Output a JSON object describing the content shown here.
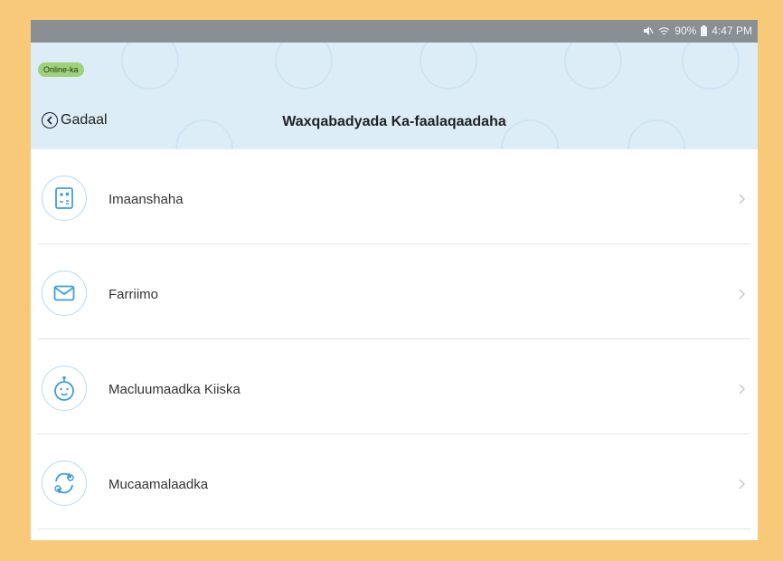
{
  "status_bar": {
    "battery": "90%",
    "time": "4:47 PM",
    "icons": [
      "mute-icon",
      "wifi-icon",
      "battery-icon"
    ]
  },
  "header": {
    "badge": "Online-ka",
    "back_label": "Gadaal",
    "title": "Waxqabadyada Ka-faalaqaadaha"
  },
  "menu": {
    "items": [
      {
        "label": "Imaanshaha",
        "icon": "calculator-icon"
      },
      {
        "label": "Farriimo",
        "icon": "envelope-icon"
      },
      {
        "label": "Macluumaadka Kiiska",
        "icon": "baby-face-icon"
      },
      {
        "label": "Mucaamalaadka",
        "icon": "exchange-icon"
      }
    ]
  },
  "colors": {
    "frame": "#f8c979",
    "status_bar": "#8a8f94",
    "header_bg": "#dcedf8",
    "badge_bg": "#9fd07a",
    "icon_blue": "#3d9ee0"
  }
}
